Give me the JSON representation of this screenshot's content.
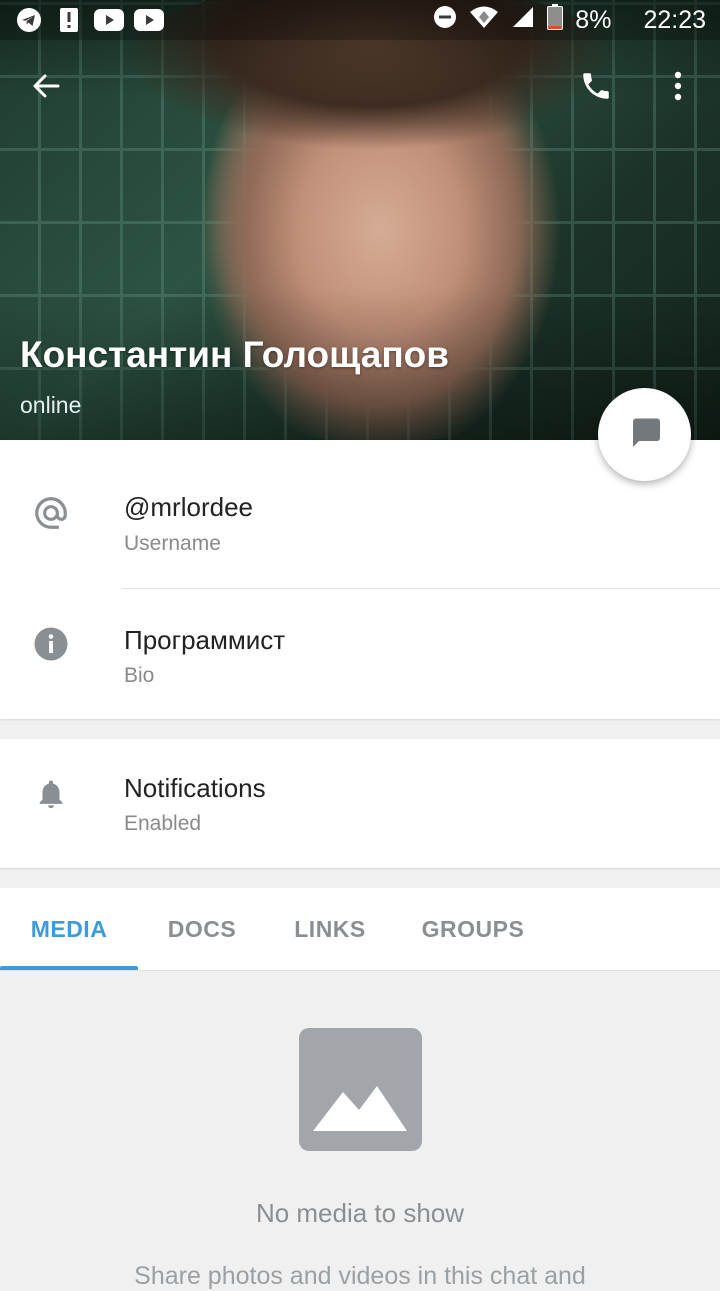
{
  "status_bar": {
    "battery": "8%",
    "time": "22:23",
    "left_icons": [
      "telegram-icon",
      "alert-icon",
      "youtube-icon",
      "youtube-icon"
    ],
    "right_icons": [
      "dnd-icon",
      "wifi-icon",
      "signal-icon",
      "battery-icon"
    ]
  },
  "header": {
    "name": "Константин Голощапов",
    "presence": "online"
  },
  "info": {
    "username": {
      "value": "@mrlordee",
      "label": "Username"
    },
    "bio": {
      "value": "Программист",
      "label": "Bio"
    }
  },
  "notifications": {
    "title": "Notifications",
    "state": "Enabled"
  },
  "tabs": [
    {
      "label": "MEDIA",
      "active": true
    },
    {
      "label": "DOCS",
      "active": false
    },
    {
      "label": "LINKS",
      "active": false
    },
    {
      "label": "GROUPS",
      "active": false
    }
  ],
  "empty_state": {
    "title": "No media to show",
    "subtitle": "Share photos and videos in this chat and"
  },
  "colors": {
    "accent": "#3d9bdc",
    "icon_gray": "#8a8f93"
  }
}
